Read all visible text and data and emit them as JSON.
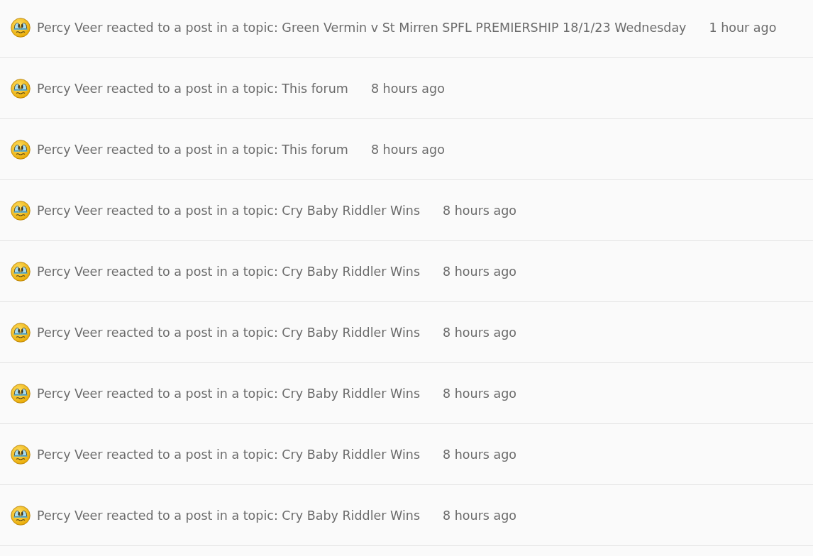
{
  "notifications": [
    {
      "message": "Percy Veer reacted to a post in a topic: Green Vermin v St Mirren SPFL PREMIERSHIP 18/1/23 Wednesday",
      "time": "1 hour ago"
    },
    {
      "message": "Percy Veer reacted to a post in a topic: This forum",
      "time": "8 hours ago"
    },
    {
      "message": "Percy Veer reacted to a post in a topic: This forum",
      "time": "8 hours ago"
    },
    {
      "message": "Percy Veer reacted to a post in a topic: Cry Baby Riddler Wins",
      "time": "8 hours ago"
    },
    {
      "message": "Percy Veer reacted to a post in a topic: Cry Baby Riddler Wins",
      "time": "8 hours ago"
    },
    {
      "message": "Percy Veer reacted to a post in a topic: Cry Baby Riddler Wins",
      "time": "8 hours ago"
    },
    {
      "message": "Percy Veer reacted to a post in a topic: Cry Baby Riddler Wins",
      "time": "8 hours ago"
    },
    {
      "message": "Percy Veer reacted to a post in a topic: Cry Baby Riddler Wins",
      "time": "8 hours ago"
    },
    {
      "message": "Percy Veer reacted to a post in a topic: Cry Baby Riddler Wins",
      "time": "8 hours ago"
    }
  ]
}
